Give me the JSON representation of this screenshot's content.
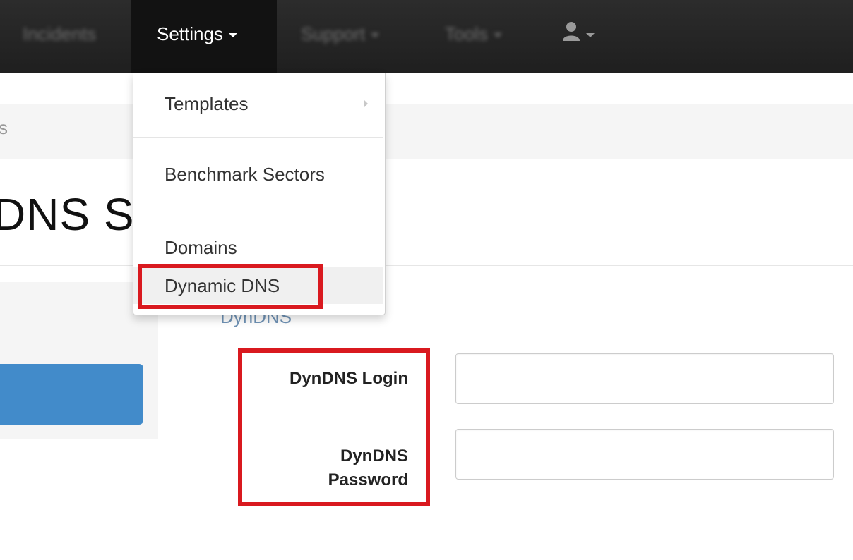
{
  "navbar": {
    "items": [
      {
        "label": "Incidents"
      },
      {
        "label": "Settings"
      },
      {
        "label": "Support"
      },
      {
        "label": "Tools"
      }
    ]
  },
  "dropdown": {
    "items": [
      {
        "label": "Templates"
      },
      {
        "label": "Benchmark Sectors"
      },
      {
        "label": "Domains"
      },
      {
        "label": "Dynamic DNS"
      }
    ]
  },
  "breadcrumb": {
    "fragment": "s"
  },
  "page": {
    "title": "DNS S"
  },
  "section": {
    "header": "DynDNS"
  },
  "form": {
    "login_label": "DynDNS Login",
    "password_label_line1": "DynDNS",
    "password_label_line2": "Password",
    "login_value": "",
    "password_value": ""
  },
  "colors": {
    "navbar_bg": "#222222",
    "highlight": "#d9191f",
    "primary_button": "#428bca",
    "section_header": "#6f92b5"
  }
}
